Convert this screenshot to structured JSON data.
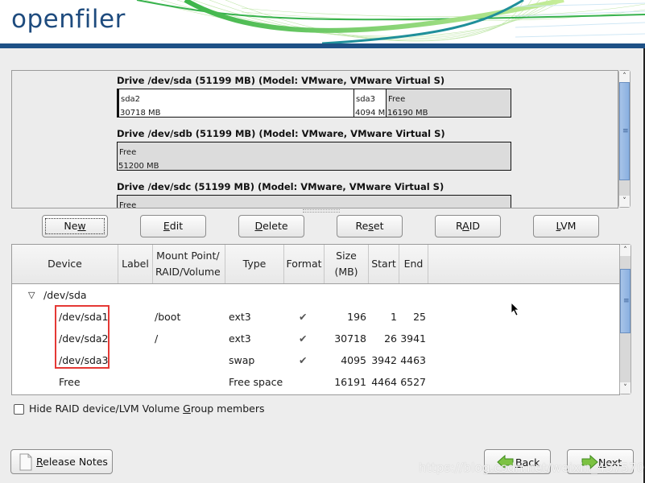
{
  "app": {
    "logo_text": "openfiler",
    "brand_color": "#1e4b7e",
    "banner_bar_color": "#1e5186"
  },
  "drives": [
    {
      "title": "Drive /dev/sda (51199 MB) (Model: VMware, VMware Virtual S)",
      "segments": [
        {
          "name": "sda2",
          "size": "30718 MB",
          "kind": "used",
          "share": 0.63
        },
        {
          "name": "sda3",
          "size": "4094 M",
          "kind": "used",
          "share": 0.08
        },
        {
          "name": "Free",
          "size": "16190 MB",
          "kind": "free",
          "share": 0.29
        }
      ]
    },
    {
      "title": "Drive /dev/sdb (51199 MB) (Model: VMware, VMware Virtual S)",
      "segments": [
        {
          "name": "Free",
          "size": "51200 MB",
          "kind": "free",
          "share": 1.0
        }
      ]
    },
    {
      "title": "Drive /dev/sdc (51199 MB) (Model: VMware, VMware Virtual S)",
      "segments": [
        {
          "name": "Free",
          "size": "",
          "kind": "free",
          "share": 1.0
        }
      ]
    }
  ],
  "toolbar": {
    "new": {
      "pre": "Ne",
      "u": "w",
      "post": ""
    },
    "edit": {
      "pre": "",
      "u": "E",
      "post": "dit"
    },
    "delete": {
      "pre": "",
      "u": "D",
      "post": "elete"
    },
    "reset": {
      "pre": "Re",
      "u": "s",
      "post": "et"
    },
    "raid": {
      "pre": "R",
      "u": "A",
      "post": "ID"
    },
    "lvm": {
      "pre": "",
      "u": "L",
      "post": "VM"
    }
  },
  "table": {
    "columns": {
      "device": "Device",
      "label": "Label",
      "mount_1": "Mount Point/",
      "mount_2": "RAID/Volume",
      "type": "Type",
      "format": "Format",
      "size_1": "Size",
      "size_2": "(MB)",
      "start": "Start",
      "end": "End"
    },
    "group": {
      "expander": "▽",
      "device": "/dev/sda"
    },
    "rows": [
      {
        "device": "/dev/sda1",
        "label": "",
        "mount": "/boot",
        "type": "ext3",
        "format": "✔",
        "size": "196",
        "start": "1",
        "end": "25"
      },
      {
        "device": "/dev/sda2",
        "label": "",
        "mount": "/",
        "type": "ext3",
        "format": "✔",
        "size": "30718",
        "start": "26",
        "end": "3941"
      },
      {
        "device": "/dev/sda3",
        "label": "",
        "mount": "",
        "type": "swap",
        "format": "✔",
        "size": "4095",
        "start": "3942",
        "end": "4463"
      },
      {
        "device": "Free",
        "label": "",
        "mount": "",
        "type": "Free space",
        "format": "",
        "size": "16191",
        "start": "4464",
        "end": "6527"
      }
    ],
    "highlight_color": "#e53935"
  },
  "options": {
    "hide_members": {
      "pre": "Hide RAID device/LVM Volume ",
      "u": "G",
      "post": "roup members",
      "checked": false
    }
  },
  "footer": {
    "release_notes": {
      "pre": "",
      "u": "R",
      "post": "elease Notes"
    },
    "back": {
      "pre": "",
      "u": "B",
      "post": "ack"
    },
    "next": {
      "pre": "",
      "u": "N",
      "post": "ext"
    }
  },
  "watermark": "https://blog.csdn.net/weixin_43757002"
}
